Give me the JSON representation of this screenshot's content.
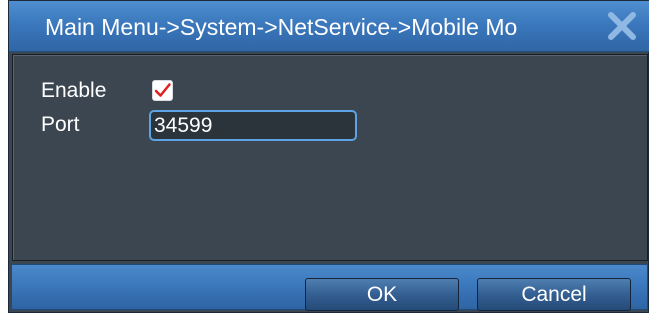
{
  "window": {
    "title": "Main Menu->System->NetService->Mobile Mo"
  },
  "form": {
    "enable_label": "Enable",
    "enable_checked": true,
    "port_label": "Port",
    "port_value": "34599"
  },
  "footer": {
    "ok_label": "OK",
    "cancel_label": "Cancel"
  },
  "icons": {
    "close": "close-icon",
    "check": "checkmark-icon"
  },
  "colors": {
    "title_bar": "#3b78bd",
    "panel": "#3b4651",
    "check_mark": "#e0201c",
    "input_border": "#5da2e3"
  }
}
